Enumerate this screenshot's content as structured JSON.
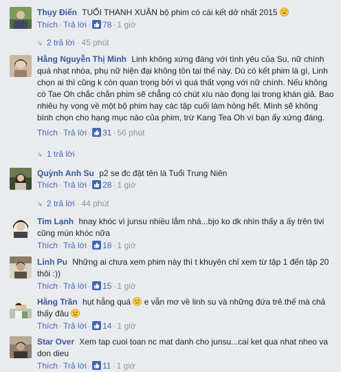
{
  "comments": [
    {
      "author": "Thụy Điển",
      "text": "TUỔI THANH XUÂN bộ phim có cái kết dở nhất 2015",
      "has_emoji": true,
      "emoji": "laugh-emoji",
      "reply_label": "Thích",
      "reply_action": "Trả lời",
      "likes": "78",
      "time": "1 giờ",
      "replies": "2 trả lời",
      "replies_time": "45 phút",
      "avatar_color": "#6a8c4e"
    },
    {
      "author": "Hằng Nguyễn Thị Minh",
      "text": "Linh không xứng đáng với tình yêu của Su, nữ chính quá nhạt nhòa, phụ nữ hiện đại không tồn tại thế này. Dù có kết phim là gì, Linh chọn ai thì cũng k còn quan trọng bởi vì quá thất vọng với nữ chính. Nếu không có Tae Oh chắc chắn phim sẽ chẳng có chút xíu nào đọng lại trong khán giả. Bao nhiêu hy vọng về một bộ phim hay các tập cuối làm hỏng hết. Mình sẽ không bình chọn cho hạng mục nào của phim, trừ Kang Tea Oh vì bạn ấy xứng đáng.",
      "reply_label": "Thích",
      "reply_action": "Trả lời",
      "likes": "31",
      "time": "56 phút",
      "replies": "1 trả lời",
      "avatar_color": "#b99a7e"
    },
    {
      "author": "Quỳnh Anh Su",
      "text": "p2 se đc đặt tên là Tuổi Trung Niên",
      "reply_label": "Thích",
      "reply_action": "Trả lời",
      "likes": "28",
      "time": "1 giờ",
      "replies": "2 trả lời",
      "replies_time": "44 phút",
      "avatar_color": "#3e4a2e"
    },
    {
      "author": "Tim Lạnh",
      "text": "hnay khóc vì junsu nhiều lắm nhá...bjo ko dk nhìn thấy a ấy trên tivi cũng mún khóc nữa",
      "reply_label": "Thích",
      "reply_action": "Trả lời",
      "likes": "18",
      "time": "1 giờ",
      "avatar_color": "#4d4d55"
    },
    {
      "author": "Linh Pu",
      "text": "Những ai chưa xem phim này thì t khuyên chỉ xem từ tập 1 đến tập 20 thôi :))",
      "reply_label": "Thích",
      "reply_action": "Trả lời",
      "likes": "15",
      "time": "1 giờ",
      "avatar_color": "#7a6a58"
    },
    {
      "author": "Hằng Trần",
      "text": "hụt hẫng quá",
      "text2": "e vẫn mơ về linh su và những đứa trẻ.thế mà chả thấy đâu",
      "reply_label": "Thích",
      "reply_action": "Trả lời",
      "likes": "14",
      "time": "1 giờ",
      "avatar_color": "#c8d0c0"
    },
    {
      "author": "Star Over",
      "text": "Xem tap cuoi toan nc mat danh cho junsu...cai ket qua nhat nheo va don dieu",
      "reply_label": "Thích",
      "reply_action": "Trả lời",
      "likes": "11",
      "time": "1 giờ",
      "avatar_color": "#5a5048"
    }
  ],
  "ui": {
    "reply_arrow": "↳"
  }
}
